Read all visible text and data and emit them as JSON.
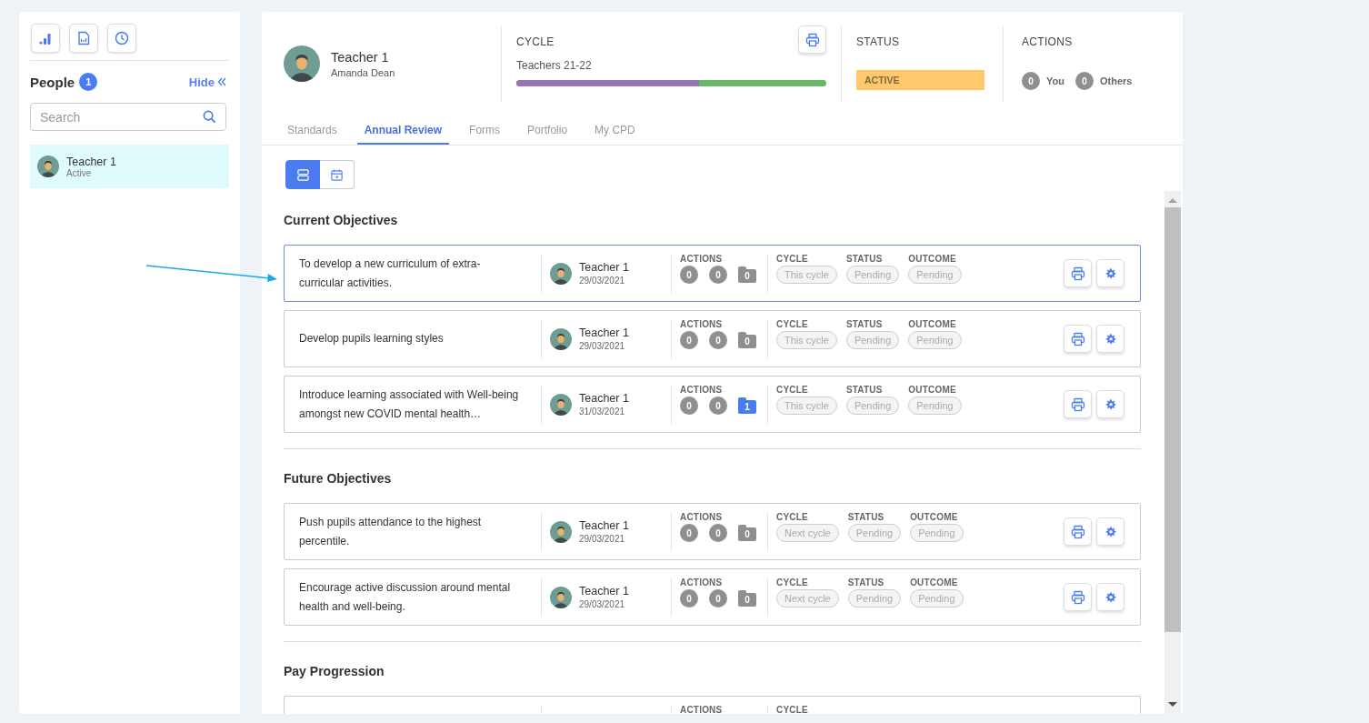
{
  "people": {
    "title": "People",
    "count": "1",
    "hide_label": "Hide",
    "search": {
      "placeholder": "Search"
    },
    "items": [
      {
        "name": "Teacher 1",
        "status": "Active",
        "selected": true
      }
    ]
  },
  "header": {
    "person": {
      "name": "Teacher 1",
      "subtitle": "Amanda Dean"
    },
    "cycle": {
      "label": "CYCLE",
      "name": "Teachers 21-22",
      "level": 0.59
    },
    "status": {
      "label": "STATUS",
      "value": "ACTIVE"
    },
    "actions": {
      "label": "ACTIONS",
      "counts": [
        {
          "count": "0",
          "label": "You"
        },
        {
          "count": "0",
          "label": "Others"
        }
      ]
    }
  },
  "tabs": [
    {
      "label": "Standards",
      "selected": false
    },
    {
      "label": "Annual Review",
      "selected": true
    },
    {
      "label": "Forms",
      "selected": false
    },
    {
      "label": "Portfolio",
      "selected": false
    },
    {
      "label": "My CPD",
      "selected": false
    }
  ],
  "view_toggle": [
    {
      "selected": true
    },
    {
      "selected": false
    }
  ],
  "sections": [
    {
      "title": "Current Objectives",
      "objectives": [
        {
          "text": "To develop a new curriculum of extra-curricular activities.",
          "selected": true,
          "teacher": "Teacher 1",
          "date": "29/03/2021",
          "actions_label": "ACTIONS",
          "counts": [
            "0",
            "0"
          ],
          "folder": {
            "count": "0",
            "active": false
          },
          "fields": [
            {
              "label": "CYCLE",
              "value": "This cycle"
            },
            {
              "label": "STATUS",
              "value": "Pending"
            },
            {
              "label": "OUTCOME",
              "value": "Pending"
            }
          ]
        },
        {
          "text": "Develop pupils learning styles",
          "selected": false,
          "teacher": "Teacher 1",
          "date": "29/03/2021",
          "actions_label": "ACTIONS",
          "counts": [
            "0",
            "0"
          ],
          "folder": {
            "count": "0",
            "active": false
          },
          "fields": [
            {
              "label": "CYCLE",
              "value": "This cycle"
            },
            {
              "label": "STATUS",
              "value": "Pending"
            },
            {
              "label": "OUTCOME",
              "value": "Pending"
            }
          ]
        },
        {
          "text": "Introduce learning associated with Well-being amongst new COVID mental health…",
          "selected": false,
          "teacher": "Teacher 1",
          "date": "31/03/2021",
          "actions_label": "ACTIONS",
          "counts": [
            "0",
            "0"
          ],
          "folder": {
            "count": "1",
            "active": true
          },
          "fields": [
            {
              "label": "CYCLE",
              "value": "This cycle"
            },
            {
              "label": "STATUS",
              "value": "Pending"
            },
            {
              "label": "OUTCOME",
              "value": "Pending"
            }
          ]
        }
      ]
    },
    {
      "title": "Future Objectives",
      "objectives": [
        {
          "text": "Push pupils attendance to the highest percentile.",
          "selected": false,
          "teacher": "Teacher 1",
          "date": "29/03/2021",
          "actions_label": "ACTIONS",
          "counts": [
            "0",
            "0"
          ],
          "folder": {
            "count": "0",
            "active": false
          },
          "fields": [
            {
              "label": "CYCLE",
              "value": "Next cycle"
            },
            {
              "label": "STATUS",
              "value": "Pending"
            },
            {
              "label": "OUTCOME",
              "value": "Pending"
            }
          ]
        },
        {
          "text": "Encourage active discussion around mental health and well-being.",
          "selected": false,
          "teacher": "Teacher 1",
          "date": "29/03/2021",
          "actions_label": "ACTIONS",
          "counts": [
            "0",
            "0"
          ],
          "folder": {
            "count": "0",
            "active": false
          },
          "fields": [
            {
              "label": "CYCLE",
              "value": "Next cycle"
            },
            {
              "label": "STATUS",
              "value": "Pending"
            },
            {
              "label": "OUTCOME",
              "value": "Pending"
            }
          ]
        }
      ]
    },
    {
      "title": "Pay Progression",
      "objectives": [
        {
          "selected": false,
          "actions_label": "ACTIONS",
          "fields": [
            {
              "label": "CYCLE"
            }
          ]
        }
      ]
    }
  ]
}
